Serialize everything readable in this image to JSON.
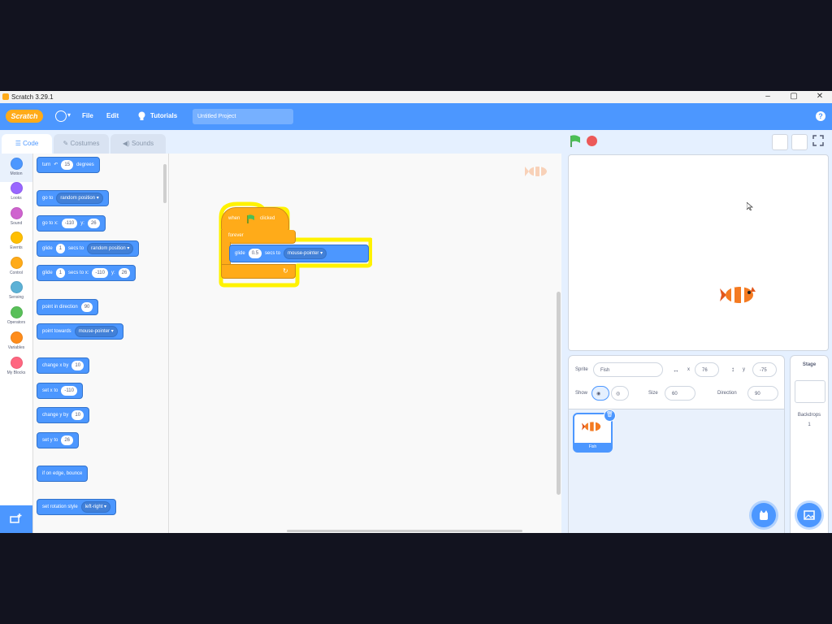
{
  "window": {
    "title": "Scratch 3.29.1",
    "minimize": "–",
    "maximize": "▢",
    "close": "✕"
  },
  "menubar": {
    "logo": "Scratch",
    "globe_caret": "▾",
    "file": "File",
    "edit": "Edit",
    "tutorials": "Tutorials",
    "project_name": "Untitled Project",
    "help": "?"
  },
  "tabs": {
    "code": "Code",
    "costumes": "Costumes",
    "sounds": "Sounds"
  },
  "categories": [
    {
      "label": "Motion",
      "color": "#4c97ff"
    },
    {
      "label": "Looks",
      "color": "#9966ff"
    },
    {
      "label": "Sound",
      "color": "#cf63cf"
    },
    {
      "label": "Events",
      "color": "#ffbf00"
    },
    {
      "label": "Control",
      "color": "#ffab19"
    },
    {
      "label": "Sensing",
      "color": "#5cb1d6"
    },
    {
      "label": "Operators",
      "color": "#59c059"
    },
    {
      "label": "Variables",
      "color": "#ff8c1a"
    },
    {
      "label": "My Blocks",
      "color": "#ff6680"
    }
  ],
  "palette": {
    "turn": {
      "text": "turn",
      "value": "15",
      "suffix": "degrees"
    },
    "goto": {
      "text": "go to",
      "dropdown": "random position ▾"
    },
    "gotoxy": {
      "text": "go to x:",
      "x": "-110",
      "ylabel": "y:",
      "y": "26"
    },
    "glide_to": {
      "text": "glide",
      "secs": "1",
      "mid": "secs to",
      "dropdown": "random position ▾"
    },
    "glide_xy": {
      "text": "glide",
      "secs": "1",
      "mid": "secs to x:",
      "x": "-110",
      "ylabel": "y:",
      "y": "26"
    },
    "point_dir": {
      "text": "point in direction",
      "value": "90"
    },
    "point_towards": {
      "text": "point towards",
      "dropdown": "mouse-pointer ▾"
    },
    "change_x": {
      "text": "change x by",
      "value": "10"
    },
    "set_x": {
      "text": "set x to",
      "value": "-110"
    },
    "change_y": {
      "text": "change y by",
      "value": "10"
    },
    "set_y": {
      "text": "set y to",
      "value": "26"
    },
    "bounce": {
      "text": "if on edge, bounce"
    },
    "rotation": {
      "text": "set rotation style",
      "dropdown": "left-right ▾"
    }
  },
  "script": {
    "hat_when": "when",
    "hat_clicked": "clicked",
    "forever": "forever",
    "glide": "glide",
    "glide_secs": "0.5",
    "glide_mid": "secs to",
    "glide_dropdown": "mouse-pointer ▾",
    "loop_arrow": "↻"
  },
  "zoom": {
    "in": "+",
    "out": "−",
    "reset": "="
  },
  "sprite_info": {
    "sprite_label": "Sprite",
    "sprite_name": "Fish",
    "x_label": "x",
    "x_value": "76",
    "y_label": "y",
    "y_value": "-75",
    "show_label": "Show",
    "size_label": "Size",
    "size_value": "60",
    "direction_label": "Direction",
    "direction_value": "90"
  },
  "sprite_list": [
    {
      "name": "Fish"
    }
  ],
  "stage_panel": {
    "title": "Stage",
    "backdrops_label": "Backdrops",
    "backdrops_count": "1"
  }
}
